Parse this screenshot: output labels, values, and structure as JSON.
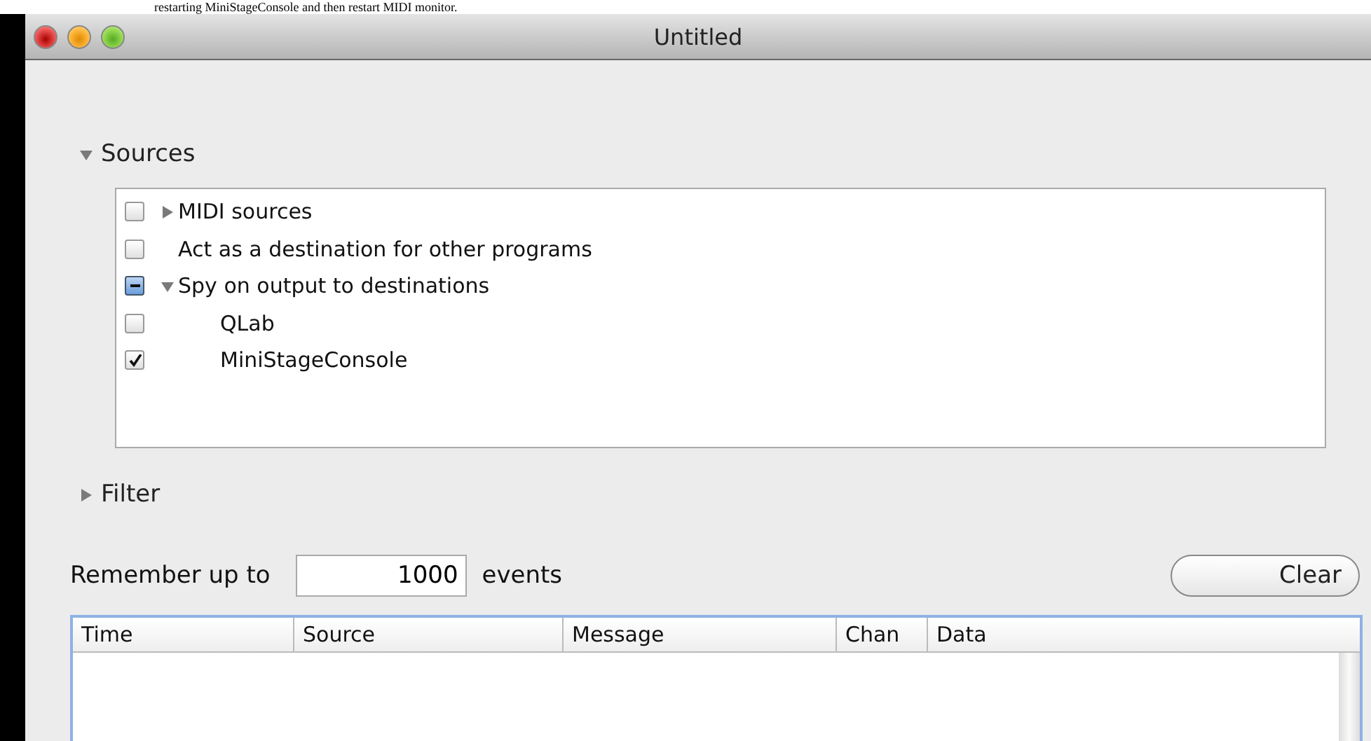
{
  "page_text": "restarting MiniStageConsole and then restart MIDI monitor.",
  "window": {
    "title": "Untitled"
  },
  "sources": {
    "label": "Sources",
    "expanded": true,
    "items": [
      {
        "label": "MIDI sources",
        "checked": false,
        "mixed": false,
        "expanded": false
      },
      {
        "label": "Act as a destination for other programs",
        "checked": false,
        "mixed": false
      },
      {
        "label": "Spy on output to destinations",
        "mixed": true,
        "expanded": true,
        "children": [
          {
            "label": "QLab",
            "checked": false,
            "mixed": false
          },
          {
            "label": "MiniStageConsole",
            "checked": true,
            "mixed": false
          }
        ]
      }
    ]
  },
  "filter": {
    "label": "Filter",
    "expanded": false
  },
  "remember": {
    "prefix": "Remember up to",
    "value": "1000",
    "suffix": "events"
  },
  "clear_button": "Clear",
  "table": {
    "columns": [
      "Time",
      "Source",
      "Message",
      "Chan",
      "Data"
    ]
  }
}
